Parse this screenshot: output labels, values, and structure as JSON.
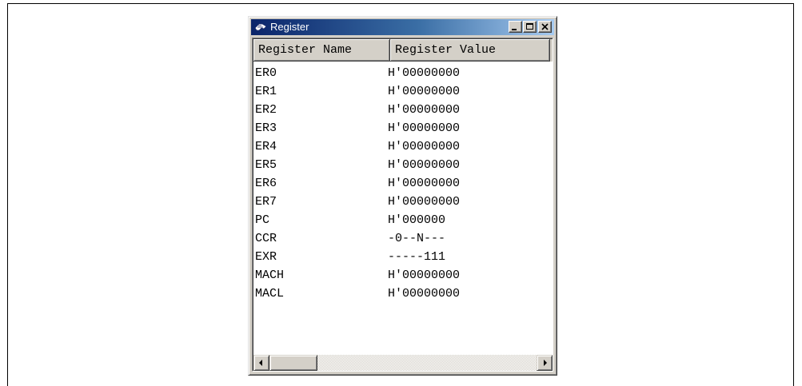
{
  "window": {
    "title": "Register"
  },
  "table": {
    "columns": [
      "Register Name",
      "Register Value"
    ],
    "rows": [
      {
        "name": "ER0",
        "value": "H'00000000"
      },
      {
        "name": "ER1",
        "value": "H'00000000"
      },
      {
        "name": "ER2",
        "value": "H'00000000"
      },
      {
        "name": "ER3",
        "value": "H'00000000"
      },
      {
        "name": "ER4",
        "value": "H'00000000"
      },
      {
        "name": "ER5",
        "value": "H'00000000"
      },
      {
        "name": "ER6",
        "value": "H'00000000"
      },
      {
        "name": "ER7",
        "value": "H'00000000"
      },
      {
        "name": "PC",
        "value": "H'000000"
      },
      {
        "name": "CCR",
        "value": "-0--N---"
      },
      {
        "name": "EXR",
        "value": "-----111"
      },
      {
        "name": "MACH",
        "value": "H'00000000"
      },
      {
        "name": "MACL",
        "value": "H'00000000"
      }
    ]
  },
  "icons": {
    "app": "register-app-icon",
    "minimize": "minimize-icon",
    "maximize": "maximize-icon",
    "close": "close-icon",
    "scroll_left": "arrow-left-icon",
    "scroll_right": "arrow-right-icon"
  },
  "colors": {
    "titlebar_start": "#0a246a",
    "titlebar_end": "#a6caf0",
    "face": "#d4d0c8"
  }
}
